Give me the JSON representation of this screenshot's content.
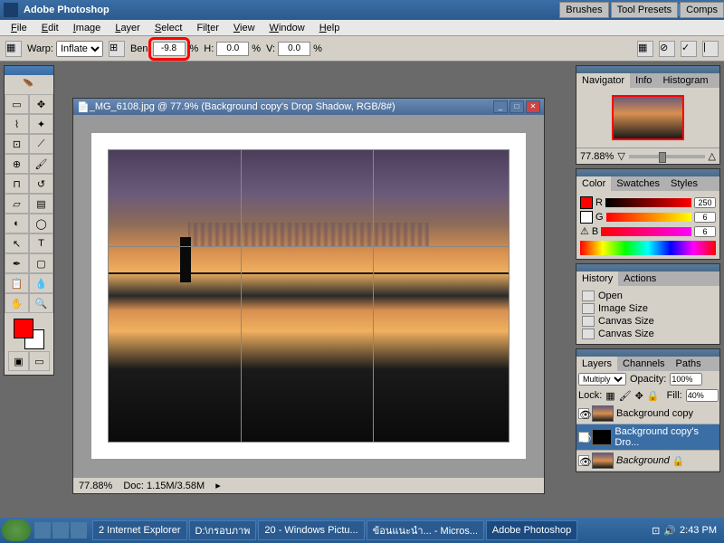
{
  "app": {
    "title": "Adobe Photoshop"
  },
  "menu": [
    "File",
    "Edit",
    "Image",
    "Layer",
    "Select",
    "Filter",
    "View",
    "Window",
    "Help"
  ],
  "options": {
    "warp_label": "Warp:",
    "warp_style": "Inflate",
    "bend_label": "Ben",
    "bend_value": "-9.8",
    "h_label": "H:",
    "h_value": "0.0",
    "v_label": "V:",
    "v_value": "0.0",
    "pct": "%"
  },
  "right_tabs": [
    "Brushes",
    "Tool Presets",
    "Comps"
  ],
  "doc": {
    "title": "_MG_6108.jpg @ 77.9% (Background copy's Drop Shadow, RGB/8#)",
    "zoom": "77.88%",
    "docsize": "Doc: 1.15M/3.58M"
  },
  "navigator": {
    "tabs": [
      "Navigator",
      "Info",
      "Histogram"
    ],
    "zoom": "77.88%"
  },
  "color": {
    "tabs": [
      "Color",
      "Swatches",
      "Styles"
    ],
    "r": "R",
    "r_val": "250",
    "g": "G",
    "g_val": "6",
    "b": "B",
    "b_val": "6"
  },
  "history": {
    "tabs": [
      "History",
      "Actions"
    ],
    "items": [
      "Open",
      "Image Size",
      "Canvas Size",
      "Canvas Size"
    ]
  },
  "layers": {
    "tabs": [
      "Layers",
      "Channels",
      "Paths"
    ],
    "blend": "Multiply",
    "opacity_label": "Opacity:",
    "opacity": "100%",
    "lock_label": "Lock:",
    "fill_label": "Fill:",
    "fill": "40%",
    "items": [
      {
        "name": "Background copy"
      },
      {
        "name": "Background copy's Dro..."
      },
      {
        "name": "Background"
      }
    ]
  },
  "taskbar": {
    "items": [
      "2 Internet Explorer",
      "D:\\กรอบภาพ",
      "20 - Windows Pictu...",
      "ข้อนแนะนำ... - Micros...",
      "Adobe Photoshop"
    ],
    "time": "2:43",
    "time_suffix": "PM"
  }
}
